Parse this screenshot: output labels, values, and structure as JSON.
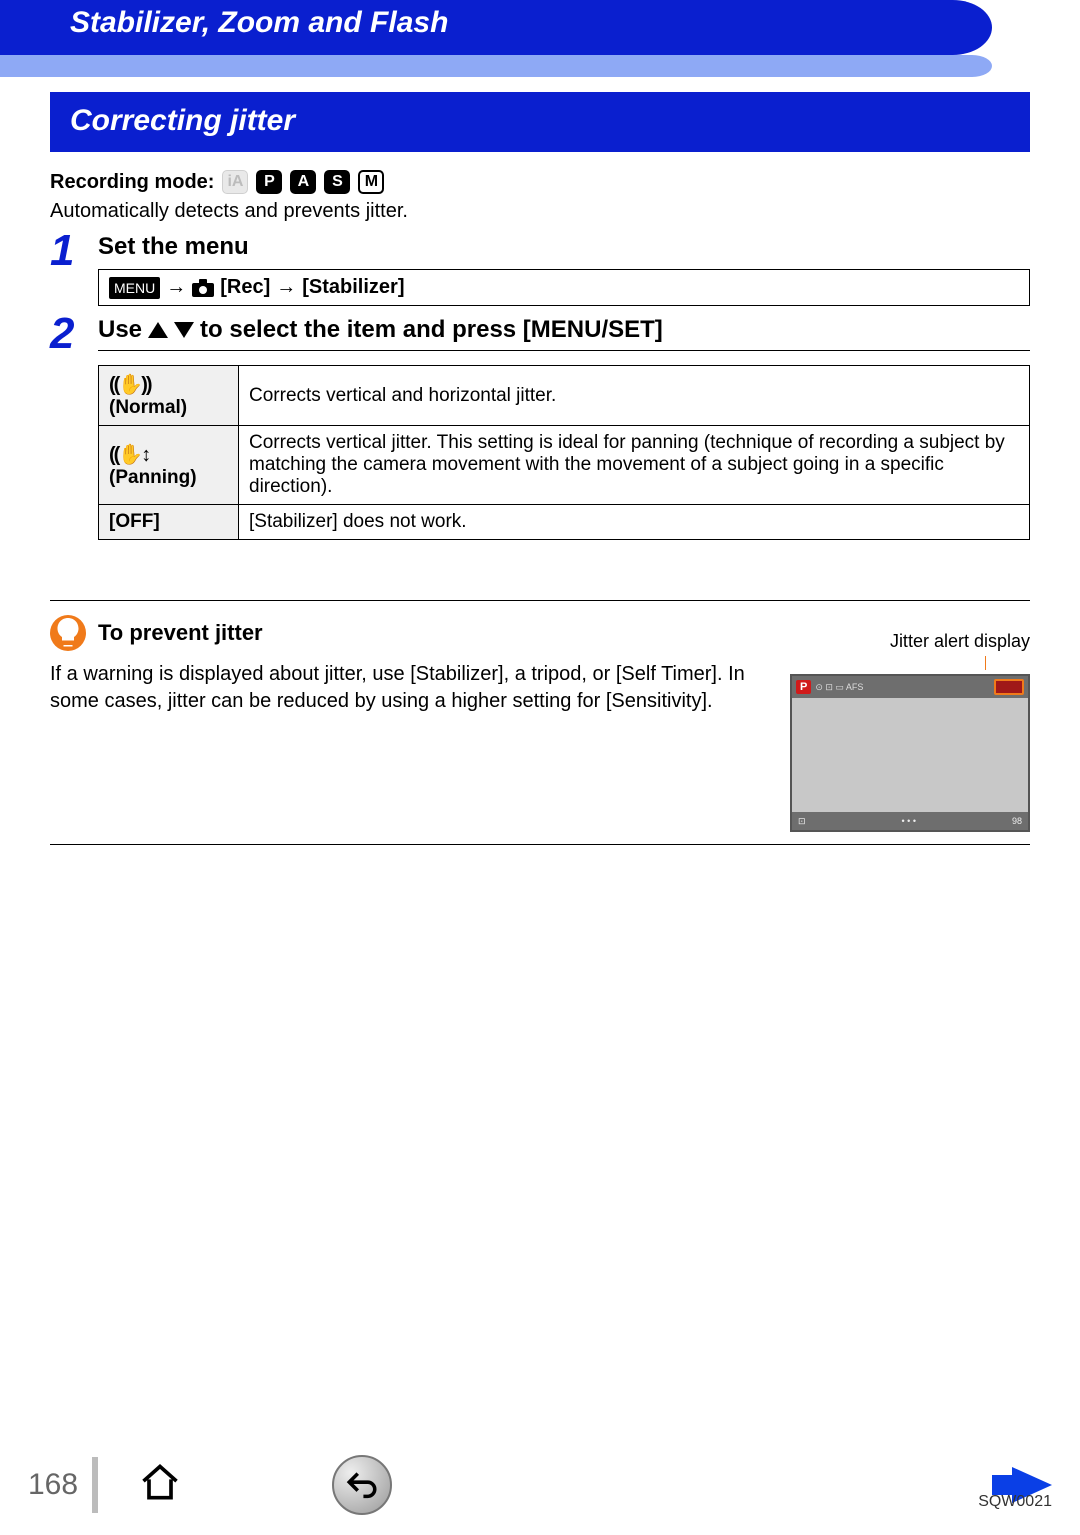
{
  "header": {
    "chapter": "Stabilizer, Zoom and Flash"
  },
  "section": {
    "title": "Correcting jitter"
  },
  "recording_mode": {
    "label": "Recording mode:",
    "modes": [
      "iA",
      "P",
      "A",
      "S",
      "M"
    ]
  },
  "intro": "Automatically detects and prevents jitter.",
  "steps": [
    {
      "num": "1",
      "title": "Set the menu",
      "menu_label": "MENU",
      "path_rec": "[Rec]",
      "path_stabilizer": "[Stabilizer]",
      "arrow": "→"
    },
    {
      "num": "2",
      "title_pre": "Use",
      "title_post": "to select the item and press [MENU/SET]"
    }
  ],
  "options": [
    {
      "name": "(Normal)",
      "desc": "Corrects vertical and horizontal jitter."
    },
    {
      "name": "(Panning)",
      "desc": "Corrects vertical jitter. This setting is ideal for panning (technique of recording a subject by matching the camera movement with the movement of a subject going in a specific direction)."
    },
    {
      "name": "[OFF]",
      "desc": "[Stabilizer] does not work."
    }
  ],
  "tip": {
    "title": "To prevent jitter",
    "body": "If a warning is displayed about jitter, use [Stabilizer], a tripod, or [Self Timer]. In some cases, jitter can be reduced by using a higher setting for [Sensitivity].",
    "preview_label": "Jitter alert display",
    "preview": {
      "mode": "P",
      "bottom_right": "98"
    }
  },
  "footer": {
    "page": "168",
    "doc_code": "SQW0021"
  }
}
